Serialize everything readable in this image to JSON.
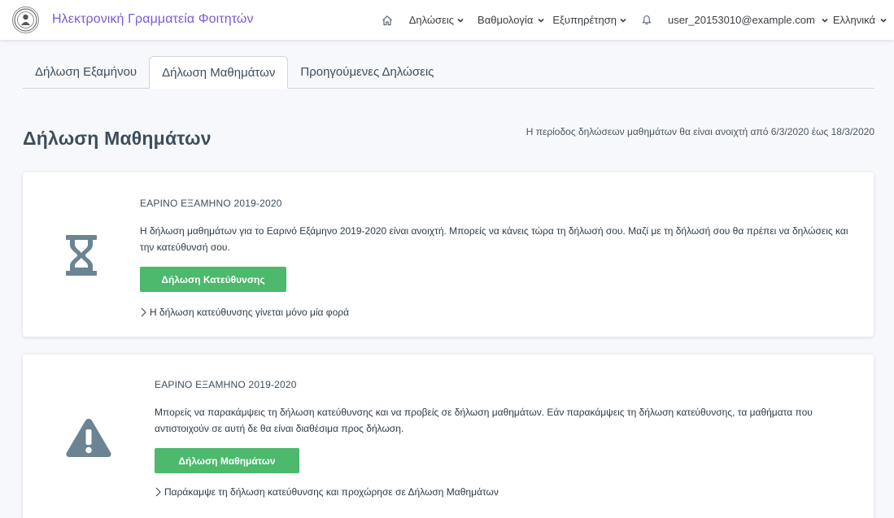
{
  "navbar": {
    "brand": "Ηλεκτρονική Γραμματεία Φοιτητών",
    "menu": {
      "declarations": "Δηλώσεις",
      "grades": "Βαθμολογία",
      "service": "Εξυπηρέτηση",
      "user": "user_20153010@example.com",
      "language": "Ελληνικά"
    }
  },
  "tabs": [
    {
      "label": "Δήλωση Εξαμήνου",
      "active": false
    },
    {
      "label": "Δήλωση Μαθημάτων",
      "active": true
    },
    {
      "label": "Προηγούμενες Δηλώσεις",
      "active": false
    }
  ],
  "page": {
    "title": "Δήλωση Μαθημάτων",
    "period": "Η περίοδος δηλώσεων μαθημάτων θα είναι ανοιχτή από 6/3/2020 έως 18/3/2020"
  },
  "cards": [
    {
      "icon": "hourglass-icon",
      "term": "ΕΑΡΙΝΟ ΕΞΑΜΗΝΟ 2019-2020",
      "text": "Η δήλωση μαθημάτων για το Εαρινό Εξάμηνο 2019-2020 είναι ανοιχτή. Μπορείς να κάνεις τώρα τη δήλωσή σου. Μαζί με τη δήλωσή σου θα πρέπει να δηλώσεις και την κατεύθυνσή σου.",
      "button": "Δήλωση Κατεύθυνσης",
      "note": "Η δήλωση κατεύθυνσης γίνεται μόνο μία φορά"
    },
    {
      "icon": "warning-icon",
      "term": "ΕΑΡΙΝΟ ΕΞΑΜΗΝΟ 2019-2020",
      "text": "Μπορείς να παρακάμψεις τη δήλωση κατεύθυνσης και να προβείς σε δήλωση μαθημάτων. Εάν παρακάμψεις τη δήλωση κατεύθυνσης, τα μαθήματα που αντιστοιχούν σε αυτή δε θα είναι διαθέσιμα προς δήλωση.",
      "button": "Δήλωση Μαθημάτων",
      "note": "Παράκαμψε τη δήλωση κατεύθυνσης και προχώρησε σε Δήλωση Μαθημάτων"
    }
  ],
  "colors": {
    "brand": "#7b5bd9",
    "button": "#4cb96c",
    "icon": "#6b8493"
  }
}
